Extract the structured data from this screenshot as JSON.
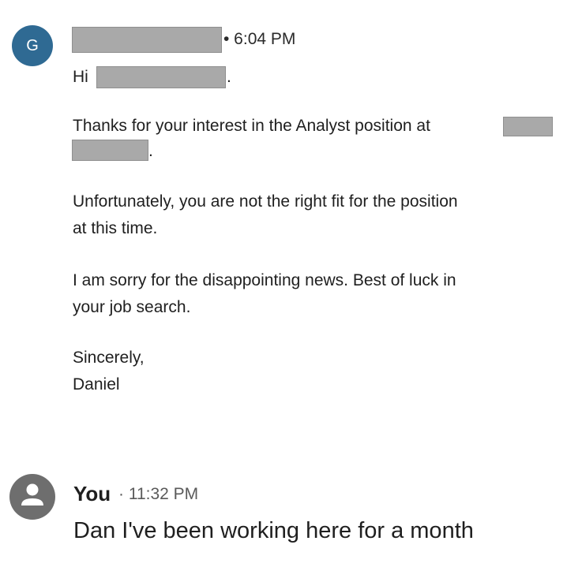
{
  "incoming": {
    "avatar_letter": "G",
    "avatar_color": "#2f6a93",
    "timestamp": "• 6:04 PM",
    "greeting": "Hi",
    "period": ".",
    "body": {
      "p1_line1": "Thanks for your interest in the Analyst position at",
      "p1_end": ".",
      "p2_line1": "Unfortunately, you are not the right fit for the position",
      "p2_line2": "at this time.",
      "p3_line1": "I am sorry for the disappointing news. Best of luck in",
      "p3_line2": "your job search.",
      "closing": "Sincerely,",
      "signature": "Daniel"
    }
  },
  "reply": {
    "avatar_icon": "person-icon",
    "sender": "You",
    "timestamp": "· 11:32 PM",
    "message": "Dan I've been working here for a month"
  }
}
